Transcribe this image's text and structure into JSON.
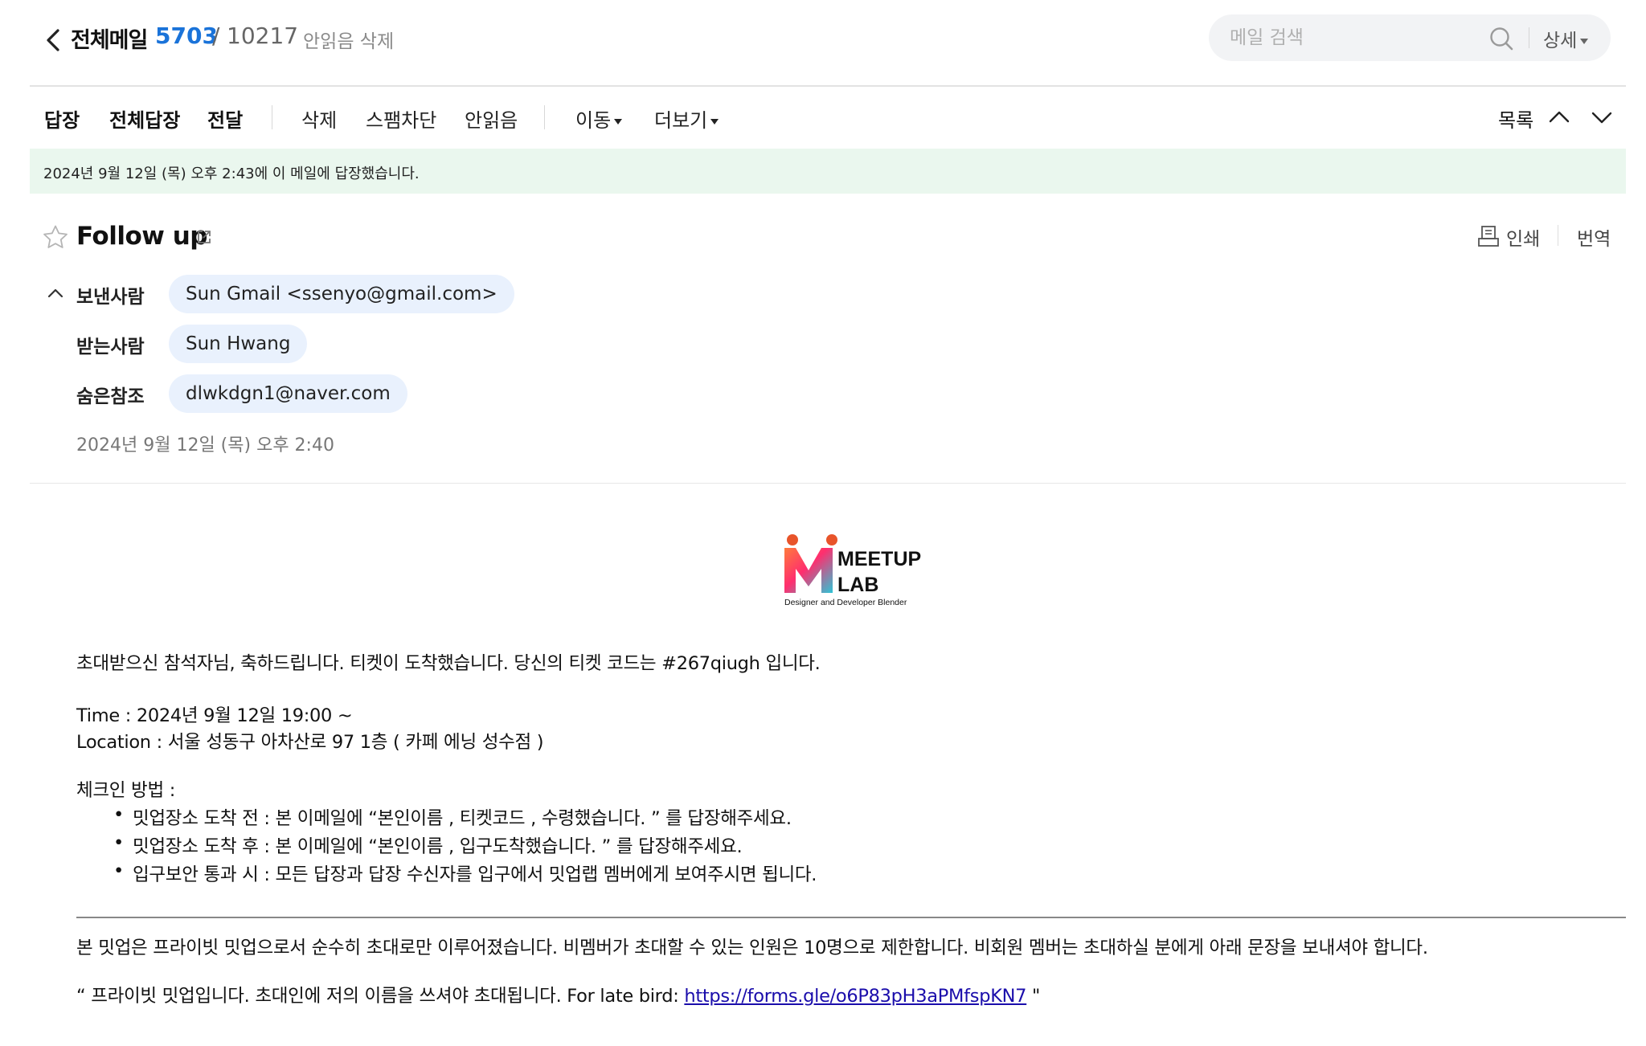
{
  "header": {
    "folder_title": "전체메일",
    "unread_count": "5703",
    "count_separator": "/",
    "total_count": "10217",
    "delete_unread_label": "안읽음 삭제",
    "search_placeholder": "메일 검색",
    "detail_label": "상세"
  },
  "toolbar": {
    "reply": "답장",
    "reply_all": "전체답장",
    "forward": "전달",
    "delete": "삭제",
    "block_spam": "스팸차단",
    "mark_unread": "안읽음",
    "move": "이동",
    "more": "더보기",
    "list": "목록"
  },
  "banner": {
    "text": "2024년 9월 12일 (목) 오후 2:43에 이 메일에 답장했습니다."
  },
  "mail": {
    "subject": "Follow up",
    "print_label": "인쇄",
    "translate_label": "번역",
    "from_label": "보낸사람",
    "from_value": "Sun Gmail <ssenyo@gmail.com>",
    "to_label": "받는사람",
    "to_value": "Sun Hwang",
    "bcc_label": "숨은참조",
    "bcc_value": "dlwkdgn1@naver.com",
    "date": "2024년 9월 12일 (목) 오후 2:40"
  },
  "logo": {
    "line1": "MEETUP",
    "line2": "LAB",
    "tagline": "Designer and Developer Blender"
  },
  "body": {
    "greeting": "초대받으신 참석자님, 축하드립니다. 티켓이 도착했습니다. 당신의 티켓 코드는 #267qiugh 입니다.",
    "time": "Time : 2024년 9월 12일 19:00 ~",
    "location": "Location : 서울 성동구 아차산로 97 1층 ( 카페 에닝 성수점 )",
    "checkin_heading": "체크인 방법 :",
    "checkin_items": [
      "밋업장소 도착 전 : 본 이메일에 “본인이름 , 티켓코드 , 수령했습니다. ” 를 답장해주세요.",
      "밋업장소 도착 후 : 본 이메일에 “본인이름 , 입구도착했습니다. ” 를 답장해주세요.",
      "입구보안 통과 시 : 모든 답장과 답장 수신자를 입구에서 밋업랩 멤버에게 보여주시면 됩니다."
    ],
    "private_note": "본 밋업은 프라이빗 밋업으로서 순수히 초대로만 이루어졌습니다. 비멤버가 초대할 수 있는 인원은 10명으로 제한합니다. 비회원 멤버는 초대하실 분에게 아래 문장을 보내셔야 합니다.",
    "quote_prefix": "“ 프라이빗 밋업입니다. 초대인에 저의 이름을 쓰셔야 초대됩니다. For late bird: ",
    "late_bird_link": "https://forms.gle/o6P83pH3aPMfspKN7",
    "quote_suffix": " \""
  },
  "colors": {
    "accent_blue": "#1a73d9",
    "banner_bg": "#eaf7ee",
    "chip_bg": "#e9f1fd",
    "search_bg": "#f2f3f5",
    "link": "#1a0dab"
  },
  "icons": [
    "back-icon",
    "search-icon",
    "chevron-up-icon",
    "chevron-down-icon",
    "star-icon",
    "popout-icon",
    "print-icon",
    "collapse-icon"
  ]
}
